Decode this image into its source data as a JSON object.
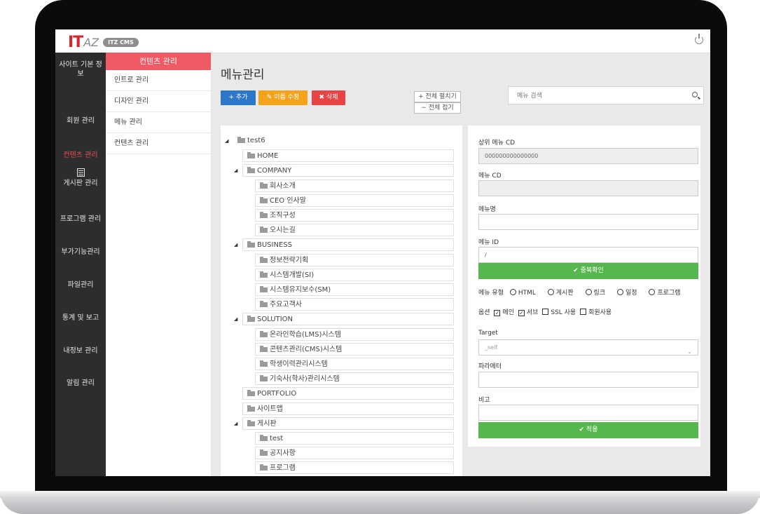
{
  "app": {
    "logo_it": "IT",
    "logo_az": "AZ",
    "logo_badge": "ITZ CMS"
  },
  "leftnav": {
    "items": [
      {
        "label": "사이트 기본 정보",
        "active": false
      },
      {
        "label": "회원 관리",
        "active": false
      },
      {
        "label": "컨텐츠 관리",
        "active": true
      },
      {
        "label": "게시판 관리",
        "active": false,
        "icon": "board-icon"
      },
      {
        "label": "프로그램 관리",
        "active": false
      },
      {
        "label": "부가기능관리",
        "active": false
      },
      {
        "label": "파일관리",
        "active": false
      },
      {
        "label": "통계 및 보고",
        "active": false
      },
      {
        "label": "내정보 관리",
        "active": false
      },
      {
        "label": "알림 관리",
        "active": false
      }
    ]
  },
  "subnav": {
    "header": "컨텐츠 관리",
    "items": [
      "인트로 관리",
      "디자인 관리",
      "메뉴 관리",
      "컨텐츠 관리"
    ]
  },
  "main": {
    "title": "메뉴관리",
    "buttons": {
      "add": "+ 추가",
      "edit": "✎ 이름 수정",
      "delete": "✖ 삭제"
    },
    "expand_all": "+ 전체 펼치기",
    "collapse_all": "− 전체 접기",
    "search_placeholder": "메뉴 검색"
  },
  "tree": [
    {
      "label": "test6",
      "level": 0,
      "expanded": true
    },
    {
      "label": "HOME",
      "level": 1
    },
    {
      "label": "COMPANY",
      "level": 1,
      "expanded": true
    },
    {
      "label": "회사소개",
      "level": 2
    },
    {
      "label": "CEO 인사말",
      "level": 2
    },
    {
      "label": "조직구성",
      "level": 2
    },
    {
      "label": "오시는길",
      "level": 2
    },
    {
      "label": "BUSINESS",
      "level": 1,
      "expanded": true
    },
    {
      "label": "정보전략기획",
      "level": 2
    },
    {
      "label": "시스템개발(SI)",
      "level": 2
    },
    {
      "label": "시스템유지보수(SM)",
      "level": 2
    },
    {
      "label": "주요고객사",
      "level": 2
    },
    {
      "label": "SOLUTION",
      "level": 1,
      "expanded": true
    },
    {
      "label": "온라인학습(LMS)시스템",
      "level": 2
    },
    {
      "label": "콘텐츠관리(CMS)시스템",
      "level": 2
    },
    {
      "label": "학생이력관리시스템",
      "level": 2
    },
    {
      "label": "기숙사(학사)관리시스템",
      "level": 2
    },
    {
      "label": "PORTFOLIO",
      "level": 1
    },
    {
      "label": "사이트맵",
      "level": 1
    },
    {
      "label": "게시판",
      "level": 1,
      "expanded": true
    },
    {
      "label": "test",
      "level": 2
    },
    {
      "label": "공지사항",
      "level": 2
    },
    {
      "label": "프로그램",
      "level": 2
    }
  ],
  "form": {
    "parent_cd_label": "상위 메뉴 CD",
    "parent_cd_value": "000000000000000",
    "menu_cd_label": "메뉴 CD",
    "menu_cd_value": "",
    "menu_name_label": "메뉴명",
    "menu_name_value": "",
    "menu_id_label": "메뉴 ID",
    "menu_id_value": "/",
    "dup_check": "✔ 중복확인",
    "type_label": "메뉴 유형",
    "type_options": [
      "HTML",
      "게시판",
      "링크",
      "일정",
      "프로그램"
    ],
    "option_label": "옵션",
    "options": [
      {
        "label": "메인",
        "checked": true
      },
      {
        "label": "서브",
        "checked": true
      },
      {
        "label": "SSL 사용",
        "checked": false
      },
      {
        "label": "회원사용",
        "checked": false
      }
    ],
    "target_label": "Target",
    "target_value": "_self",
    "param_label": "파라메터",
    "param_value": "",
    "note_label": "비고",
    "note_value": "",
    "apply": "✔ 적용"
  }
}
